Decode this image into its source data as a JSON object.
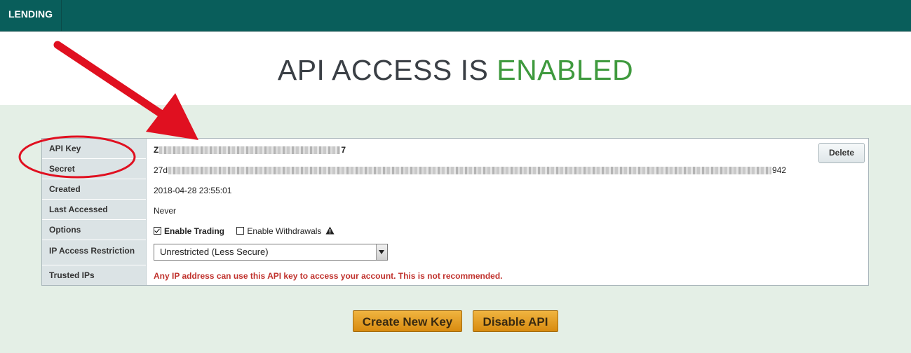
{
  "nav": {
    "lending_label": "LENDING"
  },
  "header": {
    "title_prefix": "API ACCESS IS",
    "title_status": "ENABLED"
  },
  "colors": {
    "topbar": "#095e5b",
    "enabled": "#3f9a3e",
    "warning": "#c0312c",
    "button": "#e8a52a",
    "annotation": "#e01020"
  },
  "rows": {
    "api_key": {
      "label": "API Key",
      "value_start": "Z",
      "value_end": "7"
    },
    "secret": {
      "label": "Secret",
      "value_start": "27d",
      "value_end": "942"
    },
    "created": {
      "label": "Created",
      "value": "2018-04-28 23:55:01"
    },
    "last_accessed": {
      "label": "Last Accessed",
      "value": "Never"
    },
    "options": {
      "label": "Options",
      "enable_trading": "Enable Trading",
      "enable_trading_checked": true,
      "enable_withdrawals": "Enable Withdrawals",
      "enable_withdrawals_checked": false
    },
    "ip_restriction": {
      "label": "IP Access Restriction",
      "selected": "Unrestricted (Less Secure)"
    },
    "trusted_ips": {
      "label": "Trusted IPs",
      "warning": "Any IP address can use this API key to access your account. This is not recommended."
    }
  },
  "buttons": {
    "delete": "Delete",
    "create_new_key": "Create New Key",
    "disable_api": "Disable API"
  },
  "icons": {
    "warning": "warning-icon",
    "dropdown": "chevron-down-icon"
  }
}
